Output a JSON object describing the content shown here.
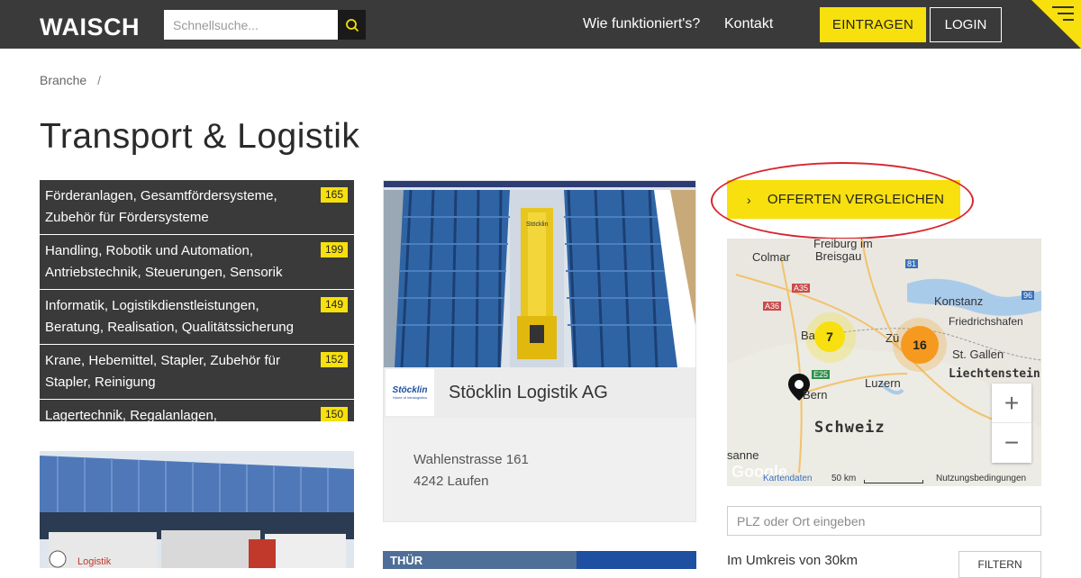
{
  "header": {
    "logo": "WAISCH",
    "search_placeholder": "Schnellsuche...",
    "nav": [
      "Wie funktioniert's?",
      "Kontakt"
    ],
    "btn_eintragen": "EINTRAGEN",
    "btn_login": "LOGIN"
  },
  "breadcrumb": {
    "item": "Branche",
    "sep": "/"
  },
  "page_title": "Transport & Logistik",
  "categories": [
    {
      "label": "Förderanlagen, Gesamtfördersysteme, Zubehör für Fördersysteme",
      "count": "165"
    },
    {
      "label": "Handling, Robotik und Automation, Antriebstechnik, Steuerungen, Sensorik",
      "count": "199"
    },
    {
      "label": "Informatik, Logistikdienstleistungen, Beratung, Realisation, Qualitätssicherung",
      "count": "149"
    },
    {
      "label": "Krane, Hebemittel, Stapler, Zubehör für Stapler, Reinigung",
      "count": "152"
    },
    {
      "label": "Lagertechnik, Regalanlagen,",
      "count": "150"
    }
  ],
  "card": {
    "logo_text": "Stöcklin",
    "logo_sub": "Home of intralogistics",
    "title": "Stöcklin Logistik AG",
    "address_line1": "Wahlenstrasse 161",
    "address_line2": "4242 Laufen",
    "rack_label": "Stöcklin"
  },
  "card2": {
    "sign": "THÜR"
  },
  "card_left2": {
    "truck_text": "Logistik"
  },
  "offerten": {
    "label": "OFFERTEN VERGLEICHEN"
  },
  "map": {
    "labels": {
      "freiburg": "Freiburg im",
      "breisgau": "Breisgau",
      "colmar": "Colmar",
      "konstanz": "Konstanz",
      "friedrichshafen": "Friedrichshafen",
      "stgallen": "St. Gallen",
      "liechtenstein": "Liechtenstein",
      "luzern": "Luzern",
      "schweiz": "Schweiz",
      "bern": "Bern",
      "lausanne": "sanne",
      "basel": "Ba",
      "zurich": "Zü"
    },
    "road_labels": [
      "A35",
      "A36",
      "81",
      "96",
      "E25"
    ],
    "clusters": [
      {
        "count": "7",
        "color": "#f7e00d"
      },
      {
        "count": "16",
        "color": "#f59a1e"
      }
    ],
    "zoom_in": "+",
    "zoom_out": "−",
    "google": "Google",
    "kartendaten": "Kartendaten",
    "scale": "50 km",
    "terms": "Nutzungsbedingungen"
  },
  "filter": {
    "plz_placeholder": "PLZ oder Ort eingeben",
    "umkreis": "Im Umkreis von 30km",
    "btn_filtern": "FILTERN"
  },
  "colors": {
    "accent": "#f7e00d",
    "dark": "#3a3a3a",
    "highlight": "#d8262f"
  }
}
